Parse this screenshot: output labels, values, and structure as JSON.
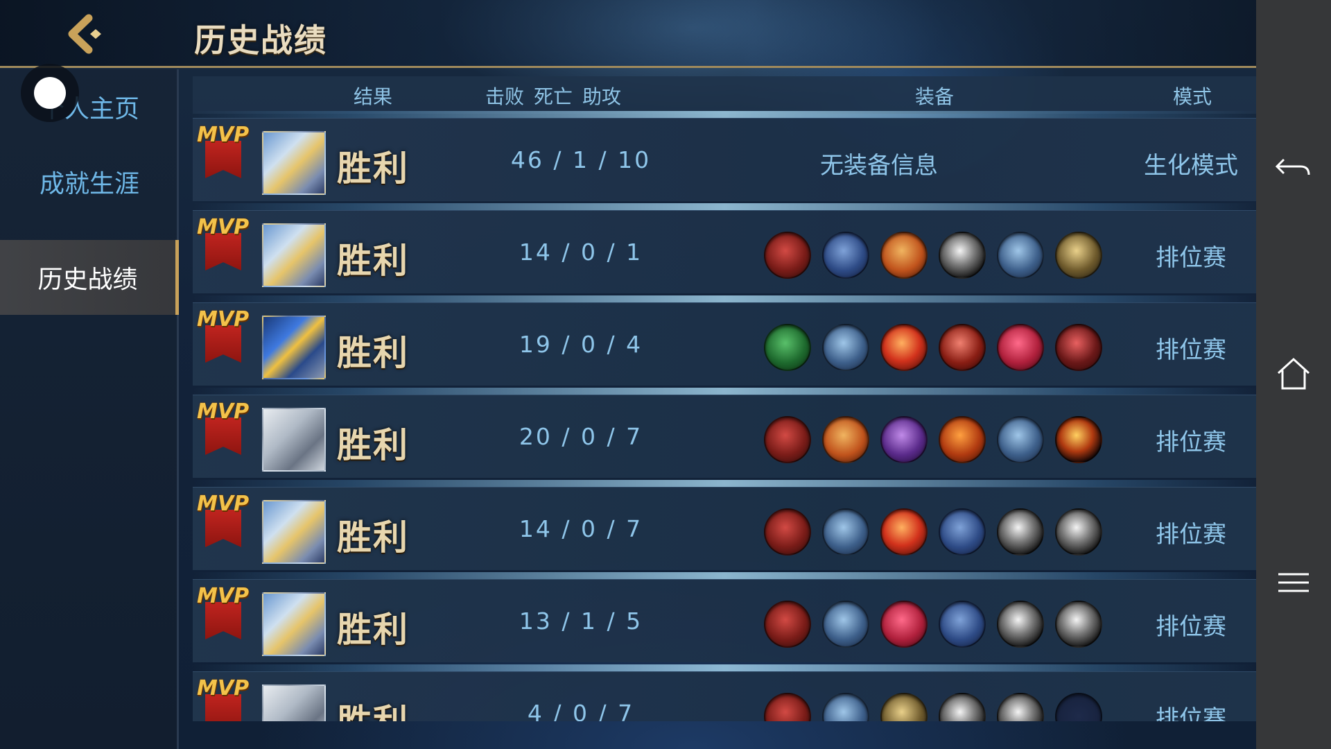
{
  "header": {
    "title": "历史战绩"
  },
  "sidebar": {
    "items": [
      {
        "label": "个人主页"
      },
      {
        "label": "成就生涯"
      },
      {
        "label": "历史战绩"
      }
    ]
  },
  "table": {
    "columns": {
      "result": "结果",
      "kills": "击败",
      "deaths": "死亡",
      "assists": "助攻",
      "equipment": "装备",
      "mode": "模式"
    },
    "no_equipment_text": "无装备信息",
    "rows": [
      {
        "mvp": "MVP",
        "result": "胜利",
        "kda": "46 / 1 / 10",
        "equipment": [],
        "mode": "生化模式",
        "avatar": "masked-knight"
      },
      {
        "mvp": "MVP",
        "result": "胜利",
        "kda": "14 / 0 / 1",
        "equipment": [
          "boots-red",
          "armor-blue",
          "shield-orange",
          "sword-silver",
          "helm-blue",
          "axe-gold"
        ],
        "mode": "排位赛",
        "avatar": "masked-knight"
      },
      {
        "mvp": "MVP",
        "result": "胜利",
        "kda": "19 / 0 / 4",
        "equipment": [
          "boots-green",
          "helm-blue",
          "cross-blades-red",
          "bow-red",
          "spear-crimson",
          "claw-red"
        ],
        "mode": "排位赛",
        "avatar": "visor-hero"
      },
      {
        "mvp": "MVP",
        "result": "胜利",
        "kda": "20 / 0 / 7",
        "equipment": [
          "boots-red",
          "shield-orange",
          "mask-purple",
          "beast-orange",
          "helm-blue",
          "eye-gold"
        ],
        "mode": "排位赛",
        "avatar": "white-beast"
      },
      {
        "mvp": "MVP",
        "result": "胜利",
        "kda": "14 / 0 / 7",
        "equipment": [
          "boots-red",
          "helm-blue",
          "cross-blades-red",
          "armor-blue",
          "sword-silver",
          "sword-silver"
        ],
        "mode": "排位赛",
        "avatar": "masked-knight"
      },
      {
        "mvp": "MVP",
        "result": "胜利",
        "kda": "13 / 1 / 5",
        "equipment": [
          "boots-red",
          "helm-blue",
          "spear-crimson",
          "armor-blue",
          "sword-silver",
          "sword-silver"
        ],
        "mode": "排位赛",
        "avatar": "masked-knight"
      },
      {
        "mvp": "MVP",
        "result": "胜利",
        "kda": "4 / 0 / 7",
        "equipment": [
          "boots-red",
          "helm-blue",
          "axe-gold",
          "sword-silver",
          "sword-silver",
          "empty-slot"
        ],
        "mode": "排位赛",
        "avatar": "white-beast"
      }
    ]
  },
  "system_nav": {
    "back": "back-arrow-icon",
    "home": "home-icon",
    "menu": "menu-icon"
  },
  "colors": {
    "accent_blue": "#8fc6ea",
    "gold": "#c9a25a",
    "mvp_red": "#c0241f"
  }
}
